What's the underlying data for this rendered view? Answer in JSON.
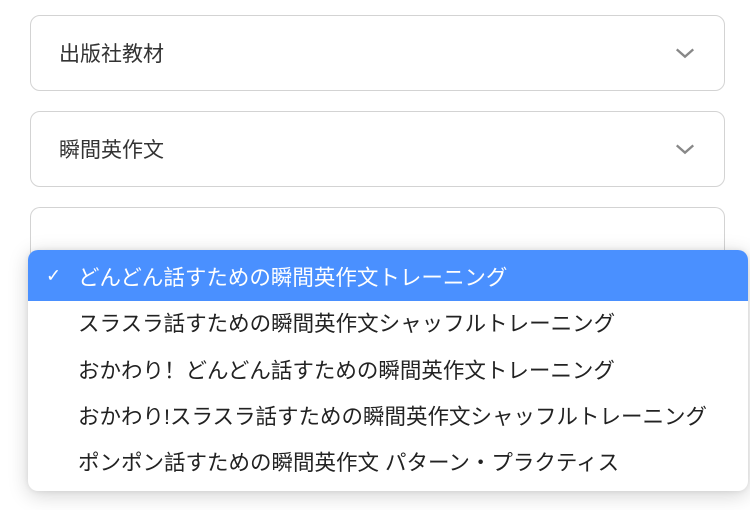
{
  "selects": [
    {
      "label": "出版社教材"
    },
    {
      "label": "瞬間英作文"
    }
  ],
  "dropdown": {
    "options": [
      {
        "label": "どんどん話すための瞬間英作文トレーニング",
        "selected": true
      },
      {
        "label": "スラスラ話すための瞬間英作文シャッフルトレーニング",
        "selected": false
      },
      {
        "label": "おかわり！どんどん話すための瞬間英作文トレーニング",
        "selected": false
      },
      {
        "label": "おかわり!スラスラ話すための瞬間英作文シャッフルトレーニング",
        "selected": false
      },
      {
        "label": "ポンポン話すための瞬間英作文 パターン・プラクティス",
        "selected": false
      }
    ]
  }
}
